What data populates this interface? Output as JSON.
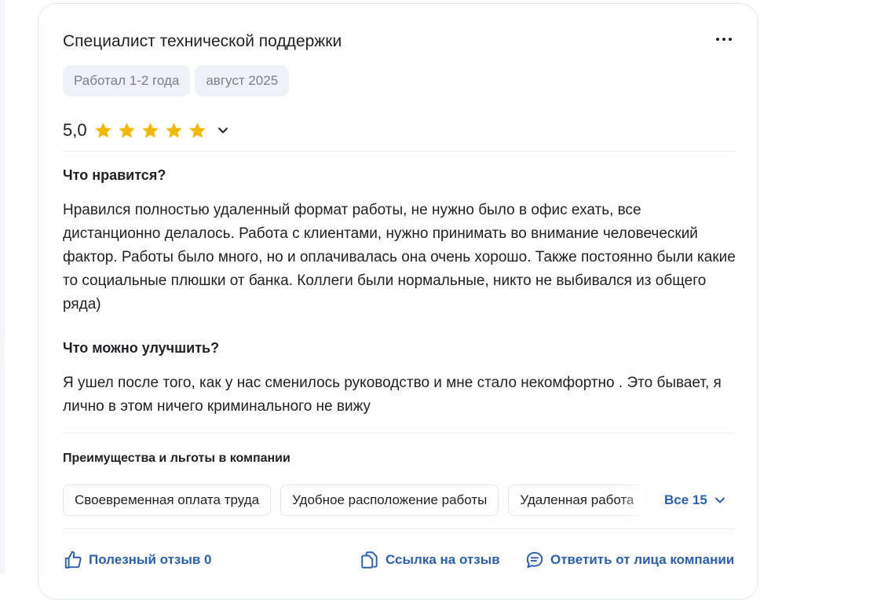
{
  "review": {
    "title": "Специалист технической поддержки",
    "tags": [
      "Работал 1-2 года",
      "август 2025"
    ],
    "rating_value": "5,0",
    "stars": 5,
    "likes_heading": "Что нравится?",
    "likes_text": "Нравился полностью удаленный формат работы, не нужно было в офис ехать, все дистанционно делалось. Работа с клиентами, нужно принимать во внимание человеческий фактор. Работы было много, но и оплачивалась она очень хорошо. Также постоянно были какие то социальные плюшки от банка. Коллеги были нормальные, никто не выбивался из общего ряда)",
    "improve_heading": "Что можно улучшить?",
    "improve_text": "Я ушел после того, как у нас сменилось руководство и мне стало некомфортно . Это бывает, я лично в этом ничего криминального не вижу"
  },
  "benefits": {
    "title": "Преимущества и льготы в компании",
    "items": [
      "Своевременная оплата труда",
      "Удобное расположение работы",
      "Удаленная работа"
    ],
    "see_all_label": "Все 15"
  },
  "actions": {
    "helpful_label": "Полезный отзыв 0",
    "link_label": "Ссылка на отзыв",
    "reply_label": "Ответить от лица компании"
  },
  "colors": {
    "accent": "#2a5fb0",
    "star": "#f5b800",
    "tag_bg": "#eef1f6"
  },
  "icons": {
    "more": "more-dots-icon",
    "star": "star-icon",
    "expand": "chevron-down-icon",
    "helpful": "thumbs-up-icon",
    "link": "copy-link-icon",
    "reply": "chat-bubble-icon"
  }
}
